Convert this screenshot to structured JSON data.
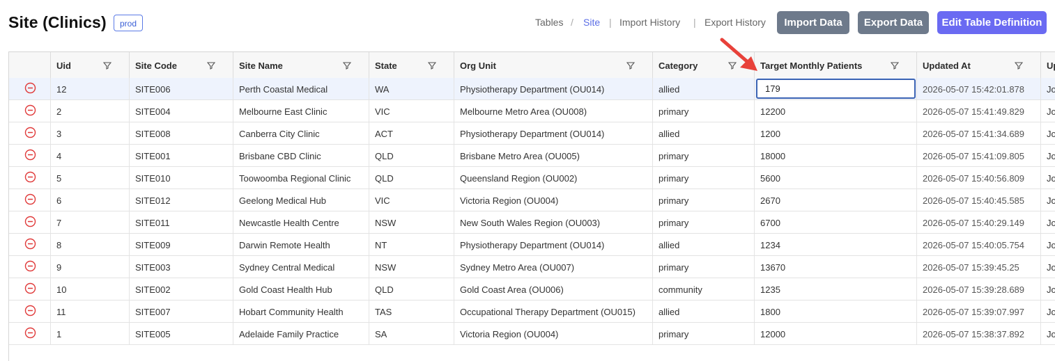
{
  "header": {
    "title": "Site (Clinics)",
    "env_badge": "prod",
    "breadcrumb": {
      "tables": "Tables",
      "separator": "/",
      "site": "Site"
    },
    "nav_divider": "|",
    "import_history": "Import History",
    "export_history": "Export History",
    "import_button": "Import Data",
    "export_button": "Export Data",
    "edit_def_button": "Edit Table Definition"
  },
  "table": {
    "columns": [
      "Uid",
      "Site Code",
      "Site Name",
      "State",
      "Org Unit",
      "Category",
      "Target Monthly Patients",
      "Updated At",
      "Up"
    ],
    "rows": [
      {
        "uid": "12",
        "code": "SITE006",
        "name": "Perth Coastal Medical",
        "state": "WA",
        "org": "Physiotherapy Department (OU014)",
        "cat": "allied",
        "target": "179",
        "updated": "2026-05-07 15:42:01.878",
        "up": "Jo"
      },
      {
        "uid": "2",
        "code": "SITE004",
        "name": "Melbourne East Clinic",
        "state": "VIC",
        "org": "Melbourne Metro Area (OU008)",
        "cat": "primary",
        "target": "12200",
        "updated": "2026-05-07 15:41:49.829",
        "up": "Jo"
      },
      {
        "uid": "3",
        "code": "SITE008",
        "name": "Canberra City Clinic",
        "state": "ACT",
        "org": "Physiotherapy Department (OU014)",
        "cat": "allied",
        "target": "1200",
        "updated": "2026-05-07 15:41:34.689",
        "up": "Jo"
      },
      {
        "uid": "4",
        "code": "SITE001",
        "name": "Brisbane CBD Clinic",
        "state": "QLD",
        "org": "Brisbane Metro Area (OU005)",
        "cat": "primary",
        "target": "18000",
        "updated": "2026-05-07 15:41:09.805",
        "up": "Jo"
      },
      {
        "uid": "5",
        "code": "SITE010",
        "name": "Toowoomba Regional Clinic",
        "state": "QLD",
        "org": "Queensland Region (OU002)",
        "cat": "primary",
        "target": "5600",
        "updated": "2026-05-07 15:40:56.809",
        "up": "Jo"
      },
      {
        "uid": "6",
        "code": "SITE012",
        "name": "Geelong Medical Hub",
        "state": "VIC",
        "org": "Victoria Region (OU004)",
        "cat": "primary",
        "target": "2670",
        "updated": "2026-05-07 15:40:45.585",
        "up": "Jo"
      },
      {
        "uid": "7",
        "code": "SITE011",
        "name": "Newcastle Health Centre",
        "state": "NSW",
        "org": "New South Wales Region (OU003)",
        "cat": "primary",
        "target": "6700",
        "updated": "2026-05-07 15:40:29.149",
        "up": "Jo"
      },
      {
        "uid": "8",
        "code": "SITE009",
        "name": "Darwin Remote Health",
        "state": "NT",
        "org": "Physiotherapy Department (OU014)",
        "cat": "allied",
        "target": "1234",
        "updated": "2026-05-07 15:40:05.754",
        "up": "Jo"
      },
      {
        "uid": "9",
        "code": "SITE003",
        "name": "Sydney Central Medical",
        "state": "NSW",
        "org": "Sydney Metro Area (OU007)",
        "cat": "primary",
        "target": "13670",
        "updated": "2026-05-07 15:39:45.25",
        "up": "Jo"
      },
      {
        "uid": "10",
        "code": "SITE002",
        "name": "Gold Coast Health Hub",
        "state": "QLD",
        "org": "Gold Coast Area (OU006)",
        "cat": "community",
        "target": "1235",
        "updated": "2026-05-07 15:39:28.689",
        "up": "Jo"
      },
      {
        "uid": "11",
        "code": "SITE007",
        "name": "Hobart Community Health",
        "state": "TAS",
        "org": "Occupational Therapy Department (OU015)",
        "cat": "allied",
        "target": "1800",
        "updated": "2026-05-07 15:39:07.997",
        "up": "Jo"
      },
      {
        "uid": "1",
        "code": "SITE005",
        "name": "Adelaide Family Practice",
        "state": "SA",
        "org": "Victoria Region (OU004)",
        "cat": "primary",
        "target": "12000",
        "updated": "2026-05-07 15:38:37.892",
        "up": "Jo"
      }
    ]
  },
  "colors": {
    "accent": "#6a6af2",
    "button_gray": "#6e7a8b",
    "delete_red": "#e03a3a",
    "annotation_arrow": "#e8413a",
    "selected_row": "#eef3fd"
  },
  "icons": {
    "row_action": "remove-circle-icon",
    "column_filter": "filter-icon",
    "annotation": "red-arrow-annotation"
  }
}
